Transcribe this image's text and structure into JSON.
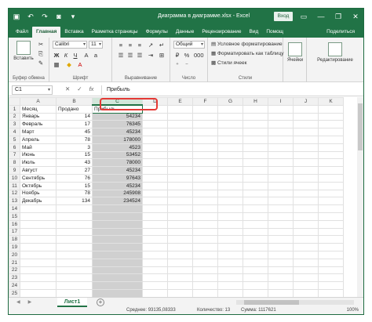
{
  "titlebar": {
    "autosave_icon": "save-icon",
    "undo_icon": "undo-icon",
    "redo_icon": "redo-icon",
    "camera_icon": "camera-icon",
    "more_icon": "customize-qat-icon",
    "title": "Диаграмма в диаграмме.xlsx - Excel",
    "login": "Вход",
    "ribbon_options_icon": "ribbon-display-icon",
    "minimize": "—",
    "restore": "❐",
    "close": "✕"
  },
  "tabs": [
    {
      "label": "Файл",
      "active": false
    },
    {
      "label": "Главная",
      "active": true
    },
    {
      "label": "Вставка",
      "active": false
    },
    {
      "label": "Разметка страницы",
      "active": false
    },
    {
      "label": "Формулы",
      "active": false
    },
    {
      "label": "Данные",
      "active": false
    },
    {
      "label": "Рецензирование",
      "active": false
    },
    {
      "label": "Вид",
      "active": false
    },
    {
      "label": "Помощ",
      "active": false
    }
  ],
  "share": "Поделиться",
  "ribbon": {
    "clipboard": {
      "paste": "Вставить",
      "label": "Буфер обмена"
    },
    "font": {
      "name": "Calibri",
      "size": "11",
      "label": "Шрифт"
    },
    "alignment": {
      "label": "Выравнивание"
    },
    "number": {
      "format": "Общий",
      "label": "Число"
    },
    "styles": {
      "conditional": "Условное форматирование",
      "as_table": "Форматировать как таблицу",
      "cell_styles": "Стили ячеек",
      "label": "Стили"
    },
    "cells": {
      "label": "Ячейки"
    },
    "editing": {
      "label": "Редактирование"
    }
  },
  "formula_bar": {
    "cell": "C1",
    "cancel": "✕",
    "enter": "✓",
    "fx": "fx",
    "content": "Прибыль"
  },
  "columns": [
    "A",
    "B",
    "C",
    "D",
    "E",
    "F",
    "G",
    "H",
    "I",
    "J",
    "K"
  ],
  "rows": [
    [
      "Месяц",
      "Продано",
      "Прибыль"
    ],
    [
      "Январь",
      "14",
      "54234"
    ],
    [
      "Февраль",
      "17",
      "76345"
    ],
    [
      "Март",
      "45",
      "45234"
    ],
    [
      "Апрель",
      "78",
      "178000"
    ],
    [
      "Май",
      "3",
      "4523"
    ],
    [
      "Июнь",
      "15",
      "53452"
    ],
    [
      "Июль",
      "43",
      "78000"
    ],
    [
      "Август",
      "27",
      "45234"
    ],
    [
      "Сентябрь",
      "76",
      "97643"
    ],
    [
      "Октябрь",
      "15",
      "45234"
    ],
    [
      "Ноябрь",
      "78",
      "245908"
    ],
    [
      "Декабрь",
      "134",
      "234524"
    ]
  ],
  "total_rows": 25,
  "sheet": {
    "name": "Лист1",
    "add": "+"
  },
  "status": {
    "average": "Среднее: 93135,08333",
    "count": "Количество: 13",
    "sum": "Сумма: 1117621",
    "zoom": "100%"
  }
}
